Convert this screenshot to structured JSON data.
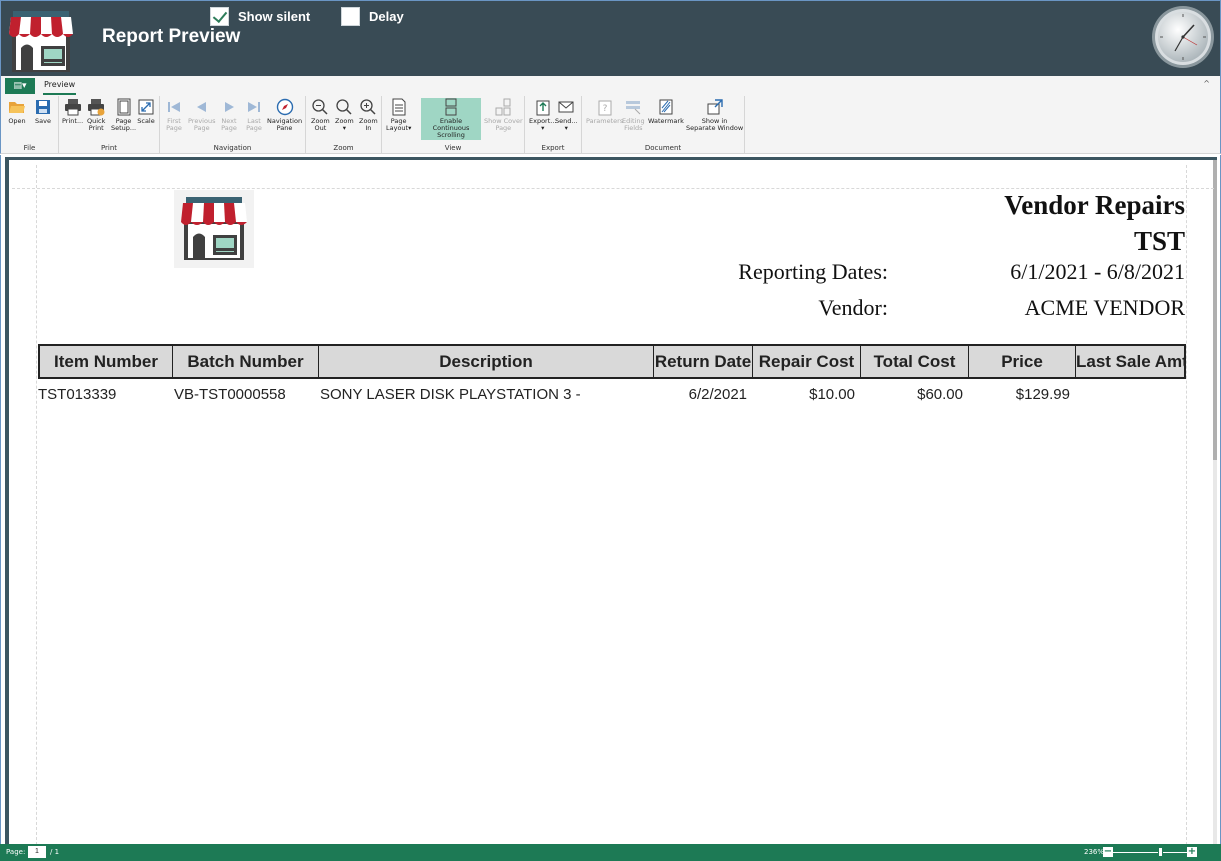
{
  "header": {
    "title": "Report Preview",
    "show_silent_label": "Show silent",
    "show_silent_checked": true,
    "delay_label": "Delay",
    "delay_checked": false
  },
  "ribbon": {
    "tab_label": "Preview",
    "groups": {
      "file": "File",
      "print": "Print",
      "navigation": "Navigation",
      "zoom": "Zoom",
      "view": "View",
      "export": "Export",
      "document": "Document"
    },
    "buttons": {
      "open": "Open",
      "save": "Save",
      "print": "Print...",
      "quick_print": "Quick\nPrint",
      "page_setup": "Page\nSetup...",
      "scale": "Scale",
      "first_page": "First\nPage",
      "previous_page": "Previous\nPage",
      "next_page": "Next\nPage",
      "last_page": "Last\nPage",
      "navigation_pane": "Navigation\nPane",
      "zoom_out": "Zoom\nOut",
      "zoom": "Zoom\n▾",
      "zoom_in": "Zoom\nIn",
      "page_layout": "Page\nLayout▾",
      "continuous_scrolling": "Enable Continuous\nScrolling",
      "show_cover_page": "Show Cover\nPage",
      "export": "Export...\n▾",
      "send": "Send...\n▾",
      "parameters": "Parameters",
      "editing_fields": "Editing\nFields",
      "watermark": "Watermark",
      "separate_window": "Show in\nSeparate Window"
    }
  },
  "report": {
    "title": "Vendor Repairs",
    "store": "TST",
    "dates_label": "Reporting Dates:",
    "dates_value": "6/1/2021 - 6/8/2021",
    "vendor_label": "Vendor:",
    "vendor_value": "ACME VENDOR",
    "columns": [
      "Item Number",
      "Batch Number",
      "Description",
      "Return Date",
      "Repair Cost",
      "Total Cost",
      "Price",
      "Last Sale Amt"
    ],
    "rows": [
      [
        "TST013339",
        "VB-TST0000558",
        "SONY LASER DISK PLAYSTATION 3 -",
        "6/2/2021",
        "$10.00",
        "$60.00",
        "$129.99",
        ""
      ]
    ]
  },
  "statusbar": {
    "page_label": "Page:",
    "page_current": "1",
    "page_total": "/ 1",
    "zoom_level": "236%"
  },
  "colors": {
    "header_bg": "#394b55",
    "accent": "#1d7a55",
    "active_button": "#9fd6c4"
  }
}
